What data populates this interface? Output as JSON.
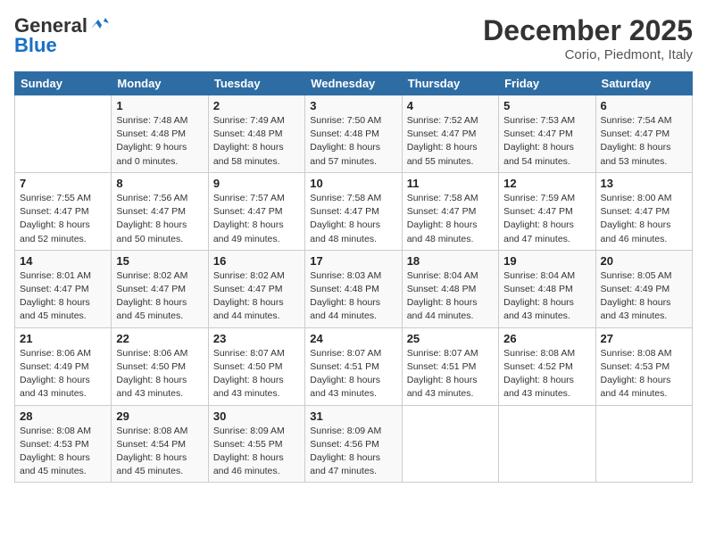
{
  "header": {
    "logo_line1": "General",
    "logo_line2": "Blue",
    "month": "December 2025",
    "location": "Corio, Piedmont, Italy"
  },
  "days_of_week": [
    "Sunday",
    "Monday",
    "Tuesday",
    "Wednesday",
    "Thursday",
    "Friday",
    "Saturday"
  ],
  "weeks": [
    [
      {
        "day": "",
        "sunrise": "",
        "sunset": "",
        "daylight": ""
      },
      {
        "day": "1",
        "sunrise": "Sunrise: 7:48 AM",
        "sunset": "Sunset: 4:48 PM",
        "daylight": "Daylight: 9 hours and 0 minutes."
      },
      {
        "day": "2",
        "sunrise": "Sunrise: 7:49 AM",
        "sunset": "Sunset: 4:48 PM",
        "daylight": "Daylight: 8 hours and 58 minutes."
      },
      {
        "day": "3",
        "sunrise": "Sunrise: 7:50 AM",
        "sunset": "Sunset: 4:48 PM",
        "daylight": "Daylight: 8 hours and 57 minutes."
      },
      {
        "day": "4",
        "sunrise": "Sunrise: 7:52 AM",
        "sunset": "Sunset: 4:47 PM",
        "daylight": "Daylight: 8 hours and 55 minutes."
      },
      {
        "day": "5",
        "sunrise": "Sunrise: 7:53 AM",
        "sunset": "Sunset: 4:47 PM",
        "daylight": "Daylight: 8 hours and 54 minutes."
      },
      {
        "day": "6",
        "sunrise": "Sunrise: 7:54 AM",
        "sunset": "Sunset: 4:47 PM",
        "daylight": "Daylight: 8 hours and 53 minutes."
      }
    ],
    [
      {
        "day": "7",
        "sunrise": "Sunrise: 7:55 AM",
        "sunset": "Sunset: 4:47 PM",
        "daylight": "Daylight: 8 hours and 52 minutes."
      },
      {
        "day": "8",
        "sunrise": "Sunrise: 7:56 AM",
        "sunset": "Sunset: 4:47 PM",
        "daylight": "Daylight: 8 hours and 50 minutes."
      },
      {
        "day": "9",
        "sunrise": "Sunrise: 7:57 AM",
        "sunset": "Sunset: 4:47 PM",
        "daylight": "Daylight: 8 hours and 49 minutes."
      },
      {
        "day": "10",
        "sunrise": "Sunrise: 7:58 AM",
        "sunset": "Sunset: 4:47 PM",
        "daylight": "Daylight: 8 hours and 48 minutes."
      },
      {
        "day": "11",
        "sunrise": "Sunrise: 7:58 AM",
        "sunset": "Sunset: 4:47 PM",
        "daylight": "Daylight: 8 hours and 48 minutes."
      },
      {
        "day": "12",
        "sunrise": "Sunrise: 7:59 AM",
        "sunset": "Sunset: 4:47 PM",
        "daylight": "Daylight: 8 hours and 47 minutes."
      },
      {
        "day": "13",
        "sunrise": "Sunrise: 8:00 AM",
        "sunset": "Sunset: 4:47 PM",
        "daylight": "Daylight: 8 hours and 46 minutes."
      }
    ],
    [
      {
        "day": "14",
        "sunrise": "Sunrise: 8:01 AM",
        "sunset": "Sunset: 4:47 PM",
        "daylight": "Daylight: 8 hours and 45 minutes."
      },
      {
        "day": "15",
        "sunrise": "Sunrise: 8:02 AM",
        "sunset": "Sunset: 4:47 PM",
        "daylight": "Daylight: 8 hours and 45 minutes."
      },
      {
        "day": "16",
        "sunrise": "Sunrise: 8:02 AM",
        "sunset": "Sunset: 4:47 PM",
        "daylight": "Daylight: 8 hours and 44 minutes."
      },
      {
        "day": "17",
        "sunrise": "Sunrise: 8:03 AM",
        "sunset": "Sunset: 4:48 PM",
        "daylight": "Daylight: 8 hours and 44 minutes."
      },
      {
        "day": "18",
        "sunrise": "Sunrise: 8:04 AM",
        "sunset": "Sunset: 4:48 PM",
        "daylight": "Daylight: 8 hours and 44 minutes."
      },
      {
        "day": "19",
        "sunrise": "Sunrise: 8:04 AM",
        "sunset": "Sunset: 4:48 PM",
        "daylight": "Daylight: 8 hours and 43 minutes."
      },
      {
        "day": "20",
        "sunrise": "Sunrise: 8:05 AM",
        "sunset": "Sunset: 4:49 PM",
        "daylight": "Daylight: 8 hours and 43 minutes."
      }
    ],
    [
      {
        "day": "21",
        "sunrise": "Sunrise: 8:06 AM",
        "sunset": "Sunset: 4:49 PM",
        "daylight": "Daylight: 8 hours and 43 minutes."
      },
      {
        "day": "22",
        "sunrise": "Sunrise: 8:06 AM",
        "sunset": "Sunset: 4:50 PM",
        "daylight": "Daylight: 8 hours and 43 minutes."
      },
      {
        "day": "23",
        "sunrise": "Sunrise: 8:07 AM",
        "sunset": "Sunset: 4:50 PM",
        "daylight": "Daylight: 8 hours and 43 minutes."
      },
      {
        "day": "24",
        "sunrise": "Sunrise: 8:07 AM",
        "sunset": "Sunset: 4:51 PM",
        "daylight": "Daylight: 8 hours and 43 minutes."
      },
      {
        "day": "25",
        "sunrise": "Sunrise: 8:07 AM",
        "sunset": "Sunset: 4:51 PM",
        "daylight": "Daylight: 8 hours and 43 minutes."
      },
      {
        "day": "26",
        "sunrise": "Sunrise: 8:08 AM",
        "sunset": "Sunset: 4:52 PM",
        "daylight": "Daylight: 8 hours and 43 minutes."
      },
      {
        "day": "27",
        "sunrise": "Sunrise: 8:08 AM",
        "sunset": "Sunset: 4:53 PM",
        "daylight": "Daylight: 8 hours and 44 minutes."
      }
    ],
    [
      {
        "day": "28",
        "sunrise": "Sunrise: 8:08 AM",
        "sunset": "Sunset: 4:53 PM",
        "daylight": "Daylight: 8 hours and 45 minutes."
      },
      {
        "day": "29",
        "sunrise": "Sunrise: 8:08 AM",
        "sunset": "Sunset: 4:54 PM",
        "daylight": "Daylight: 8 hours and 45 minutes."
      },
      {
        "day": "30",
        "sunrise": "Sunrise: 8:09 AM",
        "sunset": "Sunset: 4:55 PM",
        "daylight": "Daylight: 8 hours and 46 minutes."
      },
      {
        "day": "31",
        "sunrise": "Sunrise: 8:09 AM",
        "sunset": "Sunset: 4:56 PM",
        "daylight": "Daylight: 8 hours and 47 minutes."
      },
      {
        "day": "",
        "sunrise": "",
        "sunset": "",
        "daylight": ""
      },
      {
        "day": "",
        "sunrise": "",
        "sunset": "",
        "daylight": ""
      },
      {
        "day": "",
        "sunrise": "",
        "sunset": "",
        "daylight": ""
      }
    ]
  ]
}
